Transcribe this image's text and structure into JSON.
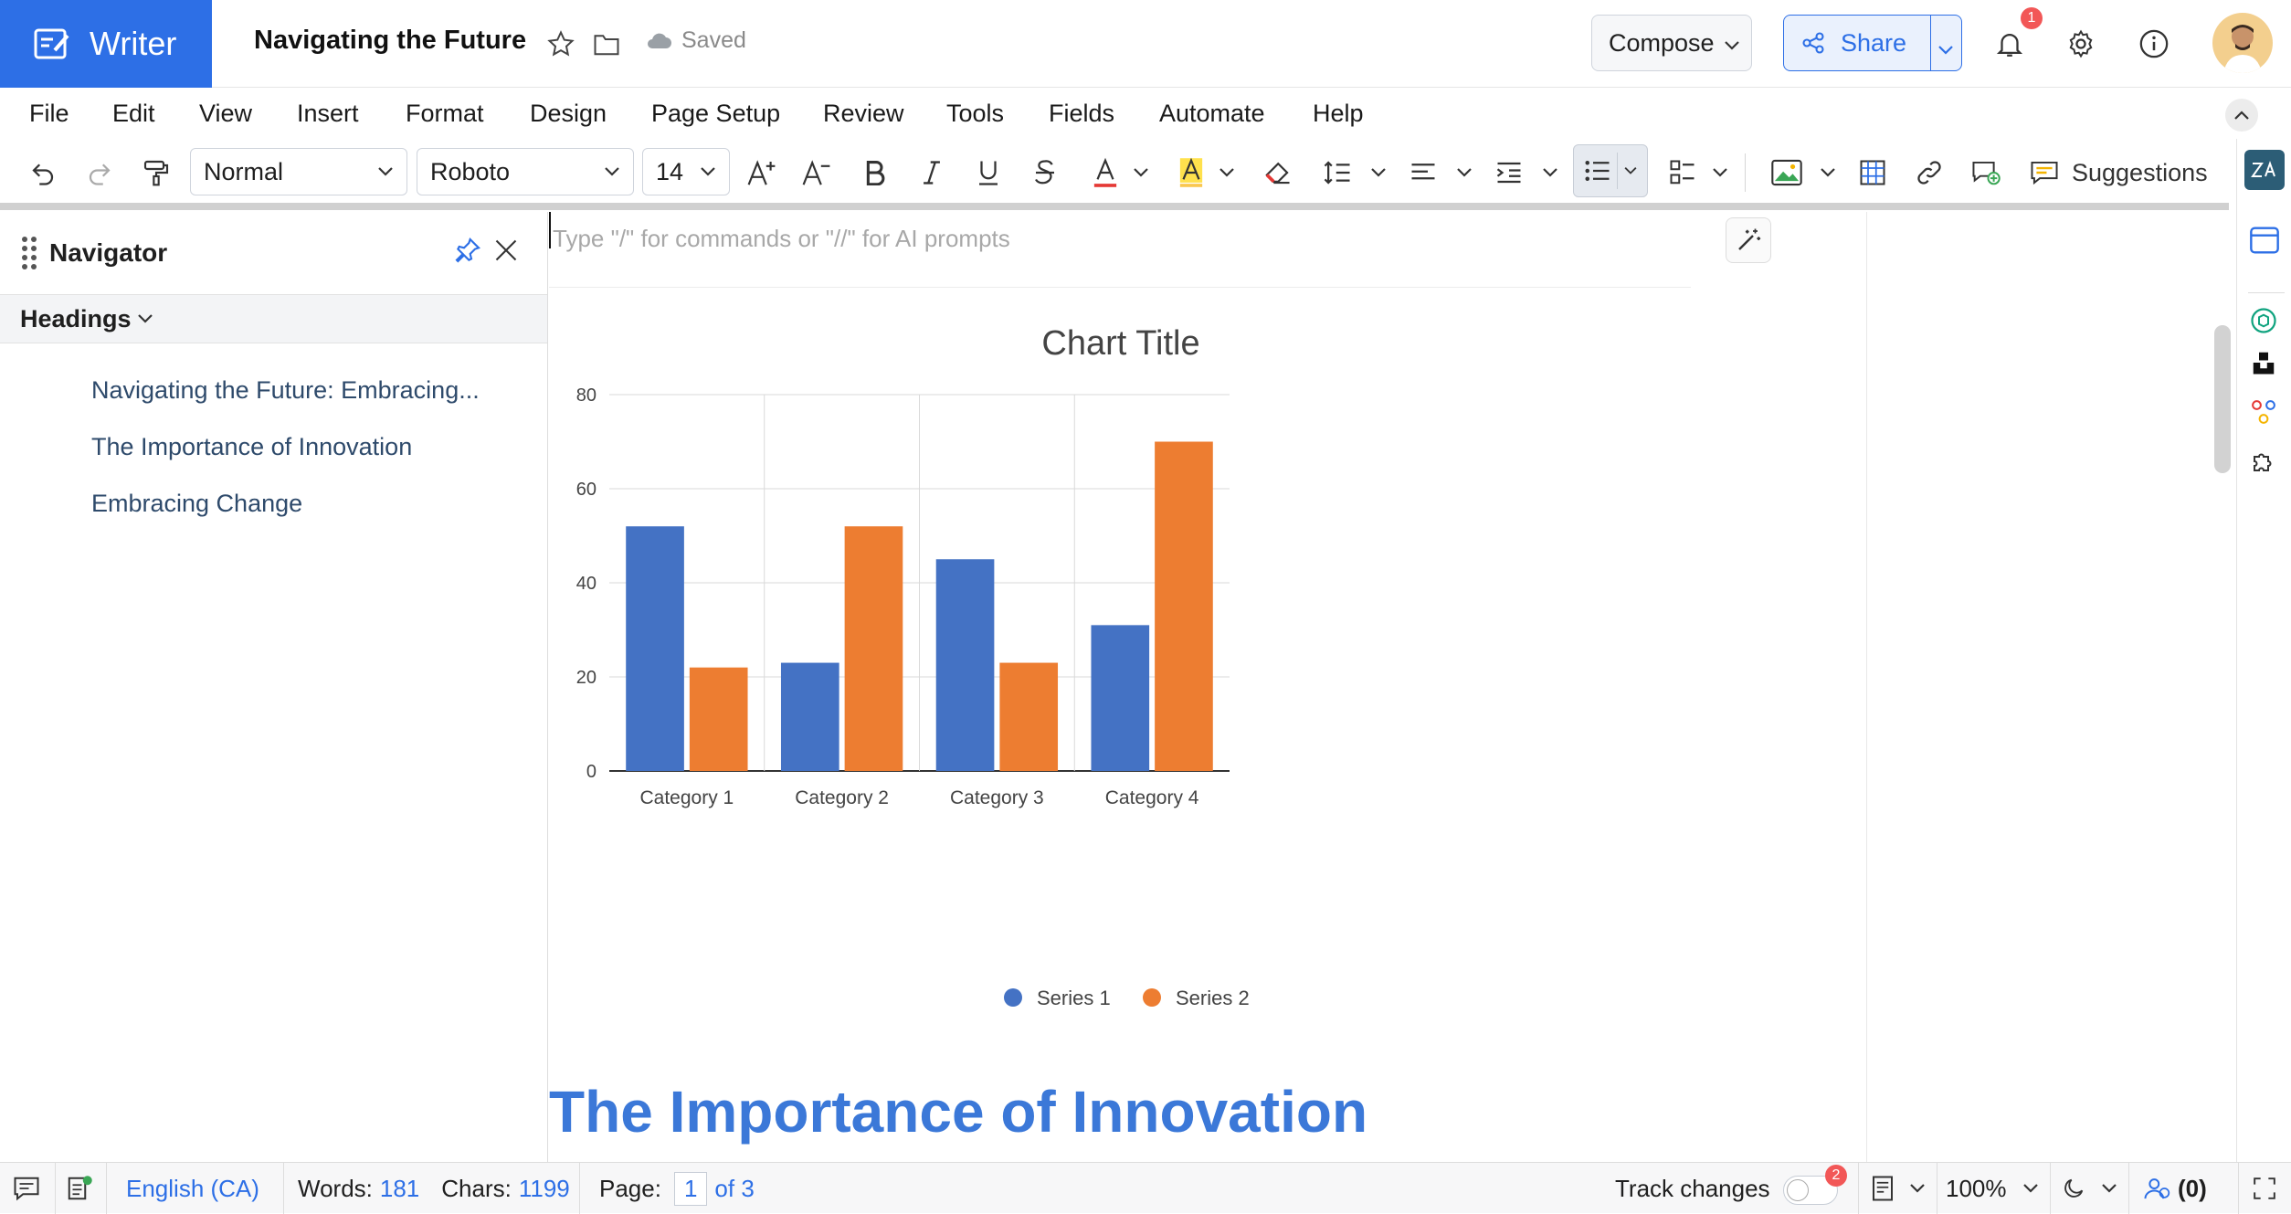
{
  "app": {
    "name": "Writer",
    "doc_title": "Navigating the Future",
    "saved_label": "Saved",
    "notifications_count": "1"
  },
  "header": {
    "compose_label": "Compose",
    "share_label": "Share"
  },
  "menu": [
    "File",
    "Edit",
    "View",
    "Insert",
    "Format",
    "Design",
    "Page Setup",
    "Review",
    "Tools",
    "Fields",
    "Automate",
    "Help"
  ],
  "toolbar": {
    "style": "Normal",
    "font": "Roboto",
    "size": "14",
    "suggestions_label": "Suggestions"
  },
  "navigator": {
    "title": "Navigator",
    "filter": "Headings",
    "items": [
      "Navigating the Future: Embracing...",
      "The Importance of Innovation",
      "Embracing Change"
    ]
  },
  "editor": {
    "placeholder": "Type \"/\" for commands or \"//\" for AI prompts",
    "heading": "The Importance of Innovation"
  },
  "chart_data": {
    "type": "bar",
    "title": "Chart Title",
    "categories": [
      "Category 1",
      "Category 2",
      "Category 3",
      "Category 4"
    ],
    "series": [
      {
        "name": "Series 1",
        "values": [
          52,
          23,
          45,
          31
        ],
        "color": "#4472c4"
      },
      {
        "name": "Series 2",
        "values": [
          22,
          52,
          23,
          70
        ],
        "color": "#ed7d31"
      }
    ],
    "ylim": [
      0,
      80
    ],
    "yticks": [
      0,
      20,
      40,
      60,
      80
    ],
    "grid": true,
    "legend": "bottom"
  },
  "status": {
    "language": "English (CA)",
    "words_label": "Words:",
    "words": "181",
    "chars_label": "Chars:",
    "chars": "1199",
    "page_label": "Page:",
    "page": "1",
    "page_total": "of 3",
    "track_changes_label": "Track changes",
    "track_badge": "2",
    "zoom": "100%",
    "collab_count": "(0)"
  }
}
